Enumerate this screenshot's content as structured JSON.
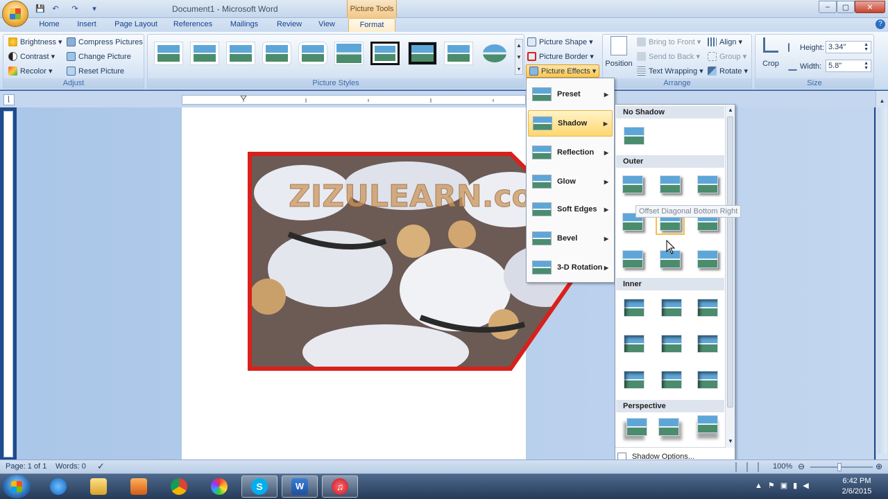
{
  "window": {
    "title": "Document1 - Microsoft Word",
    "contextual_tab": "Picture Tools",
    "min": "–",
    "max": "▢",
    "close": "✕"
  },
  "tabs": [
    "Home",
    "Insert",
    "Page Layout",
    "References",
    "Mailings",
    "Review",
    "View",
    "Format"
  ],
  "ribbon": {
    "adjust": {
      "label": "Adjust",
      "brightness": "Brightness ▾",
      "contrast": "Contrast ▾",
      "recolor": "Recolor ▾",
      "compress": "Compress Pictures",
      "change": "Change Picture",
      "reset": "Reset Picture"
    },
    "styles": {
      "label": "Picture Styles",
      "shape": "Picture Shape ▾",
      "border": "Picture Border ▾",
      "effects": "Picture Effects ▾"
    },
    "arrange": {
      "label": "Arrange",
      "position": "Position",
      "bring_front": "Bring to Front ▾",
      "send_back": "Send to Back ▾",
      "text_wrapping": "Text Wrapping ▾",
      "align": "Align ▾",
      "group": "Group ▾",
      "rotate": "Rotate ▾"
    },
    "size": {
      "label": "Size",
      "crop": "Crop",
      "height_label": "Height:",
      "height": "3.34\"",
      "width_label": "Width:",
      "width": "5.8\""
    }
  },
  "image": {
    "watermark": "ZIZULEARN.com"
  },
  "effects_menu": {
    "items": [
      "Preset",
      "Shadow",
      "Reflection",
      "Glow",
      "Soft Edges",
      "Bevel",
      "3-D Rotation"
    ],
    "highlighted": "Shadow"
  },
  "shadow_gallery": {
    "sections": [
      "No Shadow",
      "Outer",
      "Inner",
      "Perspective"
    ],
    "tooltip": "Offset Diagonal Bottom Right",
    "options": "Shadow Options..."
  },
  "status": {
    "page": "Page: 1 of 1",
    "words": "Words: 0",
    "zoom": "100%"
  },
  "taskbar": {
    "time": "6:42 PM",
    "date": "2/6/2015"
  },
  "colors": {
    "picture_border": "#d9201a",
    "highlight": "#ffd76f"
  }
}
